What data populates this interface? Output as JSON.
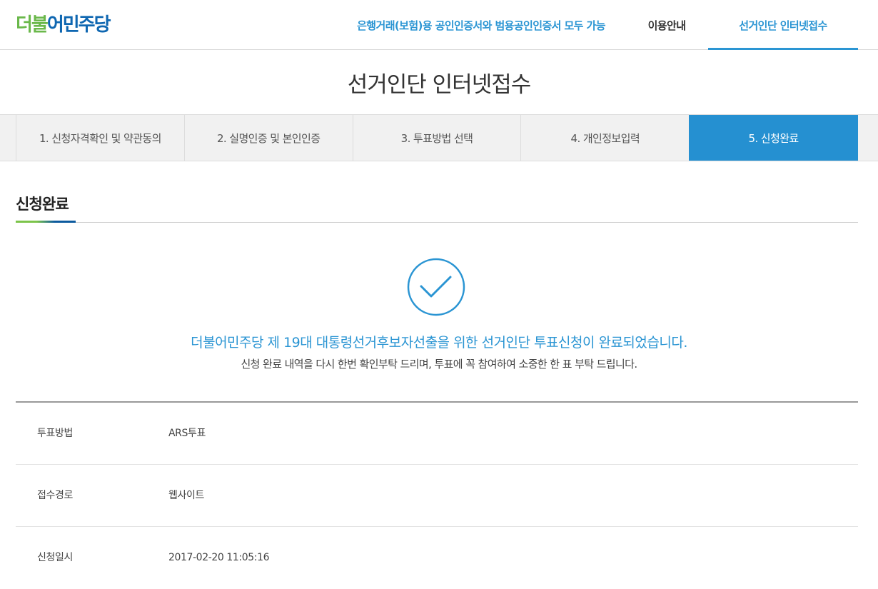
{
  "header": {
    "logo": {
      "part1": "더불",
      "part2": "어민주당"
    },
    "nav": {
      "cert_notice": "은행거래(보험)용 공인인증서와 범용공인인증서 모두 가능",
      "guide": "이용안내",
      "apply": "선거인단 인터넷접수"
    }
  },
  "page_title": "선거인단 인터넷접수",
  "steps": [
    {
      "label": "1. 신청자격확인 및 약관동의",
      "active": false
    },
    {
      "label": "2. 실명인증 및 본인인증",
      "active": false
    },
    {
      "label": "3. 투표방법 선택",
      "active": false
    },
    {
      "label": "4. 개인정보입력",
      "active": false
    },
    {
      "label": "5. 신청완료",
      "active": true
    }
  ],
  "section_title": "신청완료",
  "complete": {
    "message": "더불어민주당 제 19대 대통령선거후보자선출을 위한 선거인단 투표신청이 완료되었습니다.",
    "sub_message": "신청 완료 내역을 다시 한번 확인부탁 드리며, 투표에 꼭 참여하여 소중한 한 표 부탁 드립니다."
  },
  "info": [
    {
      "label": "투표방법",
      "value": "ARS투표"
    },
    {
      "label": "접수경로",
      "value": "웹사이트"
    },
    {
      "label": "신청일시",
      "value": "2017-02-20 11:05:16"
    }
  ],
  "icons": {
    "complete": "check-circle-icon"
  },
  "colors": {
    "accent": "#2b95d3",
    "step_active": "#2590d1",
    "logo_green": "#6ab84a",
    "logo_blue": "#0f67b1"
  }
}
